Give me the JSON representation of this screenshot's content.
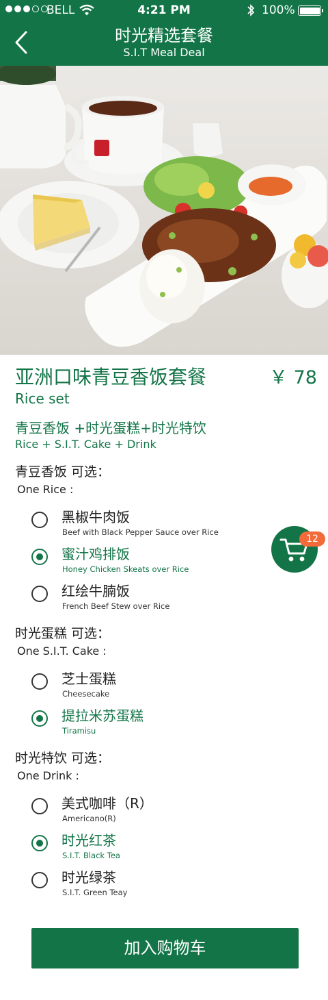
{
  "status_bar": {
    "carrier": "BELL",
    "time": "4:21 PM",
    "battery": "100%"
  },
  "header": {
    "title": "时光精选套餐",
    "subtitle": "S.I.T Meal Deal"
  },
  "product": {
    "name": "亚洲口味青豆香饭套餐",
    "name_en": "Rice set",
    "price": "￥ 78",
    "combo": "青豆香饭 +时光蛋糕+时光特饮",
    "combo_en": "Rice + S.I.T. Cake + Drink"
  },
  "sections": [
    {
      "title": "青豆香饭 可选：",
      "subtitle": "One Rice :",
      "options": [
        {
          "cn": "黑椒牛肉饭",
          "en": "Beef with Black Pepper Sauce over Rice",
          "selected": false
        },
        {
          "cn": "蜜汁鸡排饭",
          "en": "Honey Chicken Skeats over Rice",
          "selected": true
        },
        {
          "cn": "红绘牛腩饭",
          "en": "French Beef Stew over Rice",
          "selected": false
        }
      ]
    },
    {
      "title": "时光蛋糕 可选：",
      "subtitle": "One S.I.T. Cake :",
      "options": [
        {
          "cn": "芝士蛋糕",
          "en": "Cheesecake",
          "selected": false
        },
        {
          "cn": "提拉米苏蛋糕",
          "en": "Tiramisu",
          "selected": true
        }
      ]
    },
    {
      "title": "时光特饮 可选：",
      "subtitle": "One Drink :",
      "options": [
        {
          "cn": "美式咖啡（R）",
          "en": "Americano(R)",
          "selected": false
        },
        {
          "cn": "时光红茶",
          "en": "S.I.T. Black Tea",
          "selected": true
        },
        {
          "cn": "时光绿茶",
          "en": "S.I.T. Green Teay",
          "selected": false
        }
      ]
    }
  ],
  "cart": {
    "icon": "shopping-cart-icon",
    "count": "12"
  },
  "add_button": "加入购物车",
  "colors": {
    "brand": "#137547",
    "badge": "#f36b3b"
  }
}
